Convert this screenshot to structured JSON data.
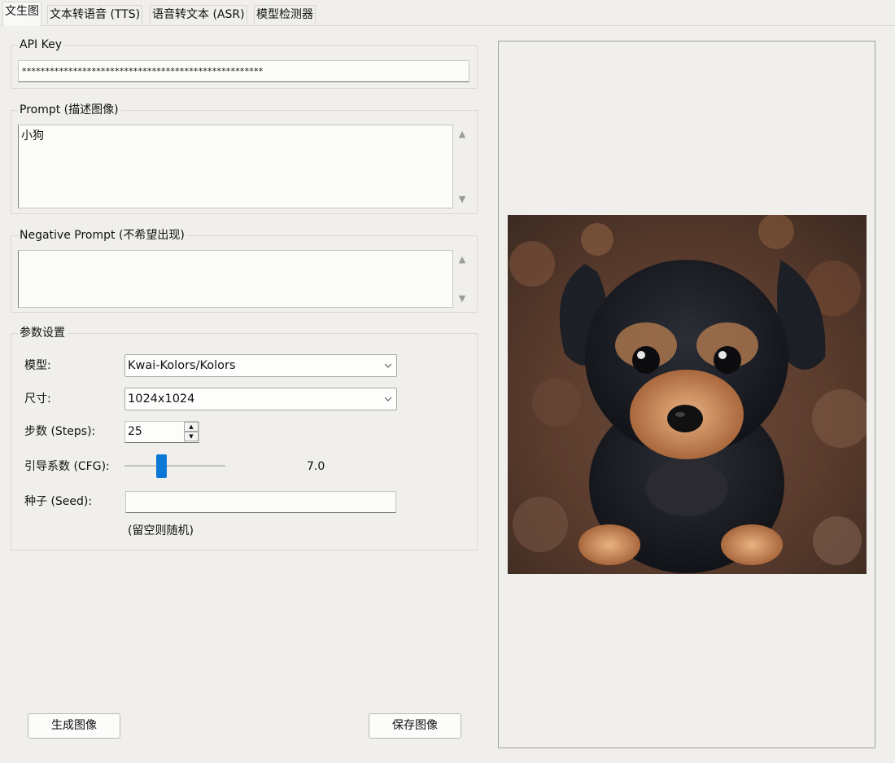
{
  "tabs": [
    {
      "label": "文生图"
    },
    {
      "label": "文本转语音 (TTS)"
    },
    {
      "label": "语音转文本 (ASR)"
    },
    {
      "label": "模型检测器"
    }
  ],
  "api_key": {
    "legend": "API Key",
    "value": "****************************************************"
  },
  "prompt": {
    "legend": "Prompt (描述图像)",
    "value": "小狗"
  },
  "negative_prompt": {
    "legend": "Negative Prompt (不希望出现)",
    "value": ""
  },
  "params": {
    "legend": "参数设置",
    "model_label": "模型:",
    "model_value": "Kwai-Kolors/Kolors",
    "size_label": "尺寸:",
    "size_value": "1024x1024",
    "steps_label": "步数 (Steps):",
    "steps_value": "25",
    "cfg_label": "引导系数 (CFG):",
    "cfg_value": "7.0",
    "seed_label": "种子 (Seed):",
    "seed_value": "",
    "seed_hint": "(留空则随机)"
  },
  "buttons": {
    "generate": "生成图像",
    "save": "保存图像"
  },
  "preview": {
    "image": "generated-puppy-image"
  },
  "colors": {
    "accent": "#0a78d7"
  }
}
